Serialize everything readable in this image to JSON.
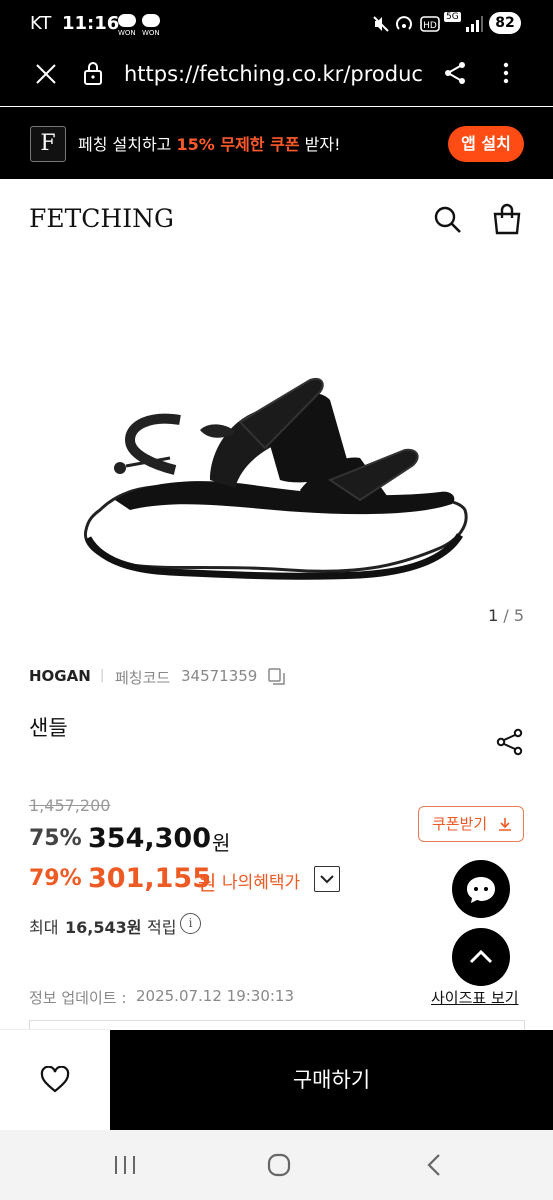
{
  "status_bar": {
    "carrier": "KT",
    "time": "11:16",
    "won_label": "WON",
    "network": "5G",
    "battery": "82"
  },
  "browser": {
    "url": "https://fetching.co.kr/produc"
  },
  "banner": {
    "logo_letter": "F",
    "text_before": "페칭 설치하고 ",
    "text_highlight": "15% 무제한 쿠폰",
    "text_after": " 받자!",
    "install_button": "앱 설치"
  },
  "header": {
    "logo": "FETCHING"
  },
  "gallery": {
    "current": "1",
    "separator": " / ",
    "total": "5"
  },
  "product": {
    "brand": "HOGAN",
    "code_label": "페칭코드",
    "code": "34571359",
    "name": "샌들",
    "original_price": "1,457,200",
    "discount_rate": "75%",
    "price": "354,300",
    "price_unit": "원",
    "best_discount_rate": "79%",
    "best_price": "301,155",
    "best_price_unit": "원",
    "my_benefit_label": "나의혜택가",
    "coupon_button": "쿠폰받기",
    "points_label": "최대",
    "points_value": "16,543원",
    "points_suffix": "적립",
    "info_mark": "i",
    "update_label": "정보 업데이트 :",
    "update_value": "2025.07.12 19:30:13",
    "size_chart_link": "사이즈표 보기"
  },
  "bottom_bar": {
    "buy_button": "구매하기"
  },
  "colors": {
    "accent": "#ee5a24",
    "install": "#ff4b14",
    "black": "#000000"
  }
}
